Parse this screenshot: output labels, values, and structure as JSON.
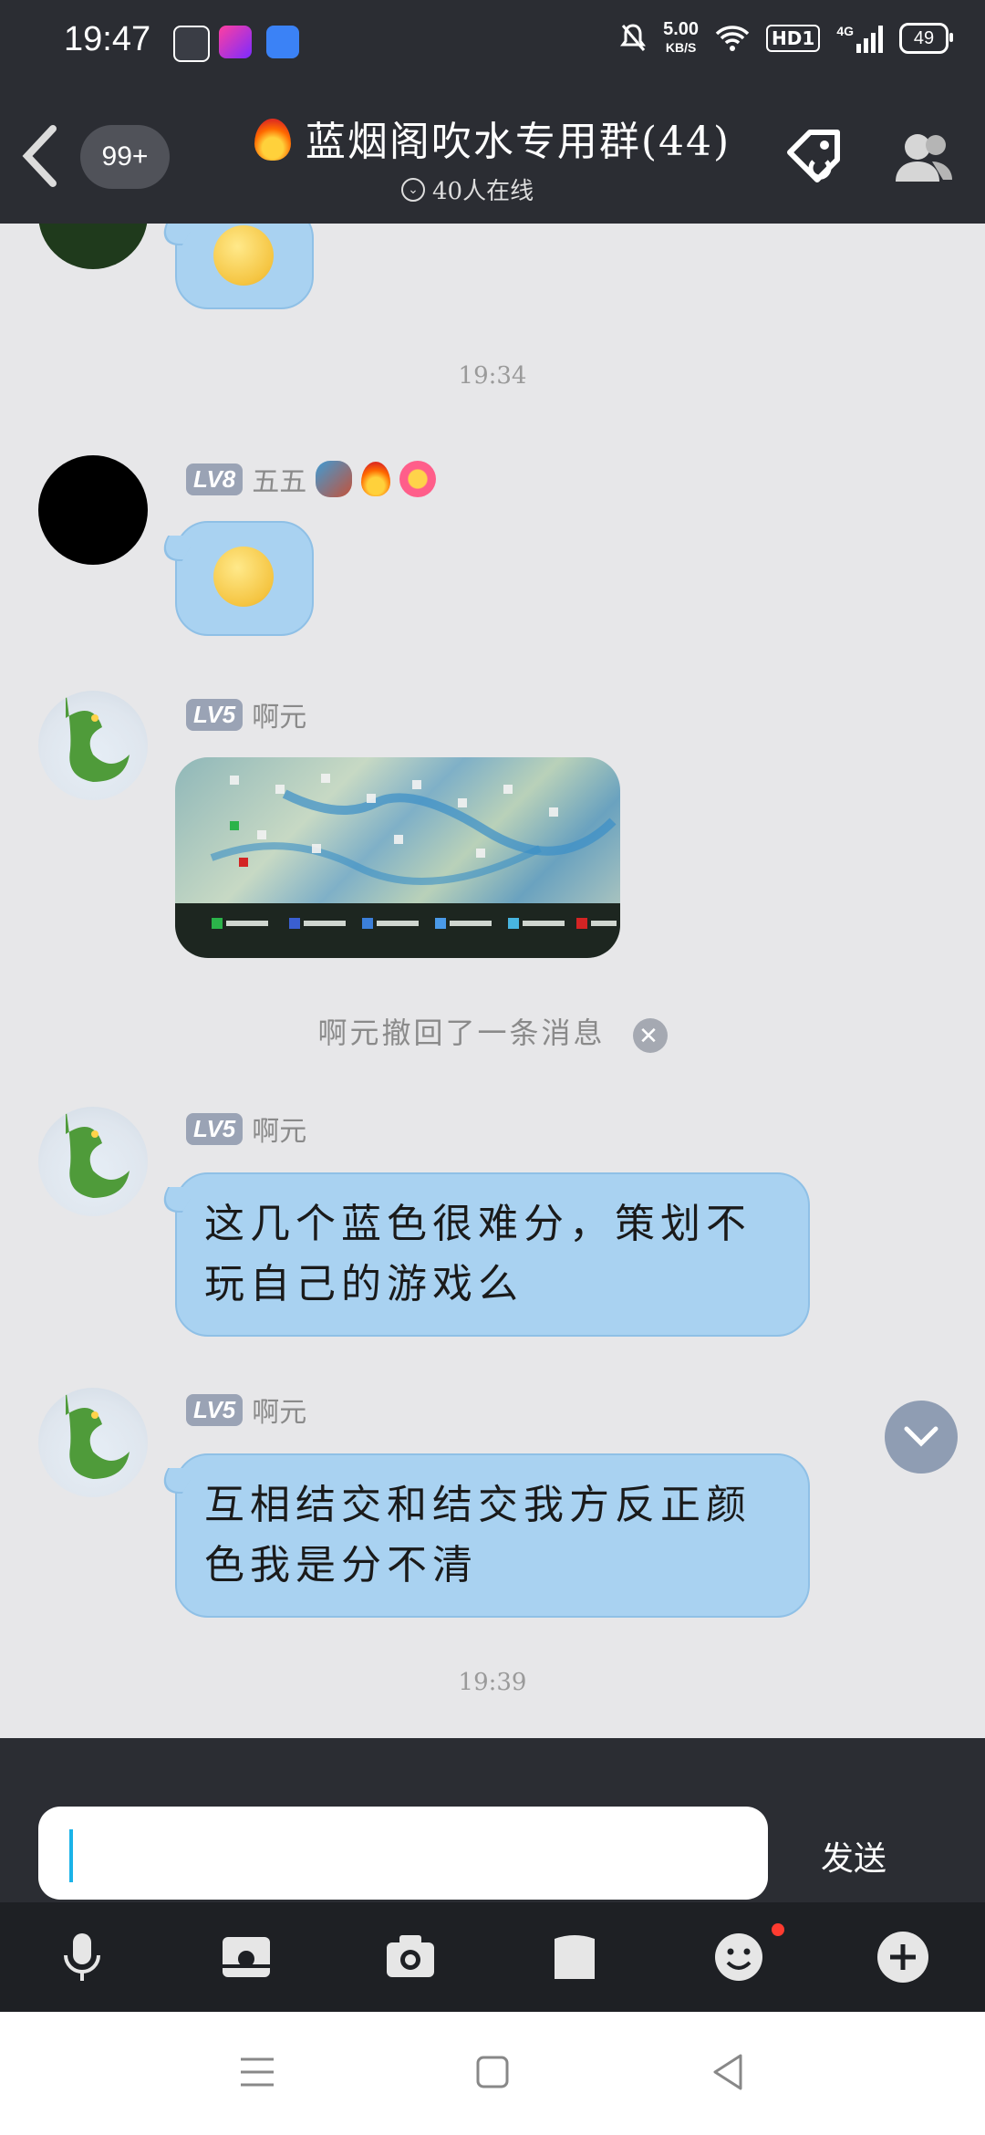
{
  "status_bar": {
    "time": "19:47",
    "net_speed": "5.00",
    "net_unit": "KB/S",
    "hd_label": "HD1",
    "signal_label": "4G",
    "battery": "49"
  },
  "header": {
    "unread_count": "99+",
    "group_title": "蓝烟阁吹水专用群(44)",
    "online_text": "40人在线"
  },
  "messages": {
    "timestamp_1": "19:34",
    "msg1": {
      "level": "LV8",
      "nickname": "五五"
    },
    "msg2": {
      "level": "LV5",
      "nickname": "啊元"
    },
    "recall_text": "啊元撤回了一条消息",
    "msg3": {
      "level": "LV5",
      "nickname": "啊元",
      "text": "这几个蓝色很难分，策划不玩自己的游戏么"
    },
    "msg4": {
      "level": "LV5",
      "nickname": "啊元",
      "text": "互相结交和结交我方反正颜色我是分不清"
    },
    "timestamp_2": "19:39"
  },
  "composer": {
    "input_value": "",
    "send_label": "发送"
  },
  "colors": {
    "bar_dark": "#2b2d33",
    "bubble": "#a9d2f1",
    "caret": "#1bb3e8"
  }
}
